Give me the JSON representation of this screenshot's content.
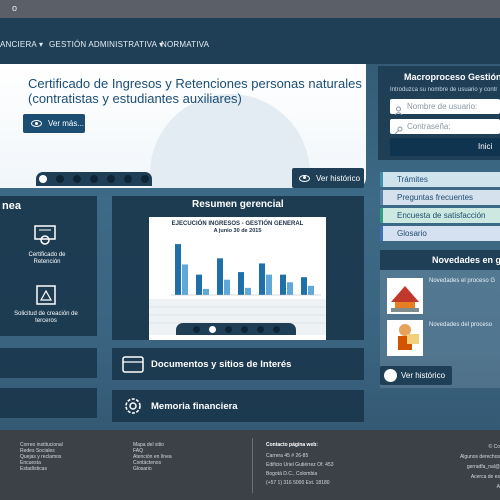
{
  "topbar": {
    "text": "o"
  },
  "nav": [
    {
      "label": "ANCIERA ▾"
    },
    {
      "label": "GESTIÓN ADMINISTRATIVA ▾"
    },
    {
      "label": "NORMATIVA"
    }
  ],
  "hero": {
    "title": "Certificado de Ingresos y Retenciones personas naturales (contratistas y estudiantes auxiliares)",
    "button": "Ver más...",
    "history_button": "Ver histórico"
  },
  "login": {
    "title": "Macroproceso Gestión A",
    "subtitle": "Introduzca su nombre de usuario y contr",
    "user_placeholder": "Nombre de usuario:",
    "pass_placeholder": "Contraseña:",
    "submit": "Inici"
  },
  "quick_links": [
    {
      "label": "Trámites",
      "color": "#3f8fb0"
    },
    {
      "label": "Preguntas frecuentes",
      "color": "#5a7fa8"
    },
    {
      "label": "Encuesta de satisfacción",
      "color": "#2f9e82"
    },
    {
      "label": "Glosario",
      "color": "#3e72b5"
    }
  ],
  "news": {
    "title": "Novedades en g",
    "items": [
      {
        "text": "Novedades el proceso G"
      },
      {
        "text": "Novedades del proceso"
      }
    ],
    "history_button": "Ver histórico"
  },
  "linea": {
    "title": "nea",
    "services": [
      {
        "label": "Certificado de Retención"
      },
      {
        "label": "Solicitud de creación de terceros"
      }
    ]
  },
  "resumen": {
    "title": "Resumen gerencial",
    "chart_title": "EJECUCIÓN INGRESOS - GESTIÓN GENERAL",
    "chart_subtitle": "A junio 30 de 2015"
  },
  "chart_data": {
    "type": "bar",
    "title": "EJECUCIÓN INGRESOS - GESTIÓN GENERAL",
    "subtitle": "A junio 30 de 2015",
    "categories": [
      "A",
      "B",
      "C",
      "D",
      "E",
      "F",
      "G"
    ],
    "series": [
      {
        "values": [
          100,
          40,
          72,
          45,
          62,
          40,
          35
        ],
        "color": "#1f6fa8"
      },
      {
        "values": [
          60,
          12,
          30,
          14,
          40,
          25,
          18
        ],
        "color": "#5fa8d8"
      }
    ],
    "ylim": [
      0,
      110
    ]
  },
  "docs": {
    "label": "Documentos y sitios de Interés"
  },
  "memoria": {
    "label": "Memoria financiera"
  },
  "footer": {
    "col1": [
      "Correo institucional",
      "Redes Sociales",
      "Quejas y reclamos",
      "Encuesta",
      "Estadísticas"
    ],
    "col2": [
      "Mapa del sitio",
      "FAQ",
      "Atención en línea",
      "Contáctenos",
      "Glosario"
    ],
    "contact_title": "Contacto página web:",
    "contact": [
      "Carrera 45 # 26-85",
      "Edificio Uriel Gutiérrez Of. 453",
      "Bogotá D.C., Colombia",
      "(+57 1) 316 5000 Ext. 18180"
    ],
    "right": [
      "© Co",
      "Algunos derechos",
      "gerradfa_nal@",
      "Acerca de es",
      "A"
    ]
  }
}
